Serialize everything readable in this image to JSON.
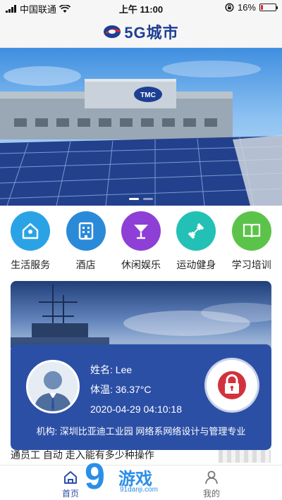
{
  "status_bar": {
    "carrier": "中国联通",
    "time": "上午 11:00",
    "battery": "16%",
    "battery_level": 0.16,
    "icons": [
      "signal-icon",
      "wifi-icon",
      "rotation-lock-icon",
      "battery-icon"
    ]
  },
  "header": {
    "logo_text": "5G城市",
    "brand_color": "#1d3f93",
    "logo_icon": "e-swoosh-logo"
  },
  "banner": {
    "sign_text": "TMC",
    "slide_count": 2,
    "active_slide": 1
  },
  "categories": [
    {
      "label": "生活服务",
      "icon": "home-location-icon",
      "color": "#2aa3e6"
    },
    {
      "label": "酒店",
      "icon": "building-icon",
      "color": "#2a8ad8"
    },
    {
      "label": "休闲娱乐",
      "icon": "cocktail-icon",
      "color": "#8e3fd6"
    },
    {
      "label": "运动健身",
      "icon": "dumbbell-icon",
      "color": "#23c1b5"
    },
    {
      "label": "学习培训",
      "icon": "book-icon",
      "color": "#5cc34a"
    }
  ],
  "card": {
    "name_line": "姓名: Lee",
    "temp_line": "体温: 36.37°C",
    "datetime": "2020-04-29 04:10:18",
    "org_line": "机构: 深圳比亚迪工业园  网络系网络设计与管理专业",
    "panel_color": "#2c4fa6",
    "lock_icon": "lock-icon",
    "lock_color": "#d2323c"
  },
  "news": {
    "headline": "通员工  自动  走入能有多少种操作"
  },
  "tabs": [
    {
      "label": "首页",
      "icon": "home-icon",
      "active": true
    },
    {
      "label": "我的",
      "icon": "person-icon",
      "active": false
    }
  ],
  "watermark": {
    "text": "游戏",
    "number": "9",
    "sub": "91danji.com"
  }
}
